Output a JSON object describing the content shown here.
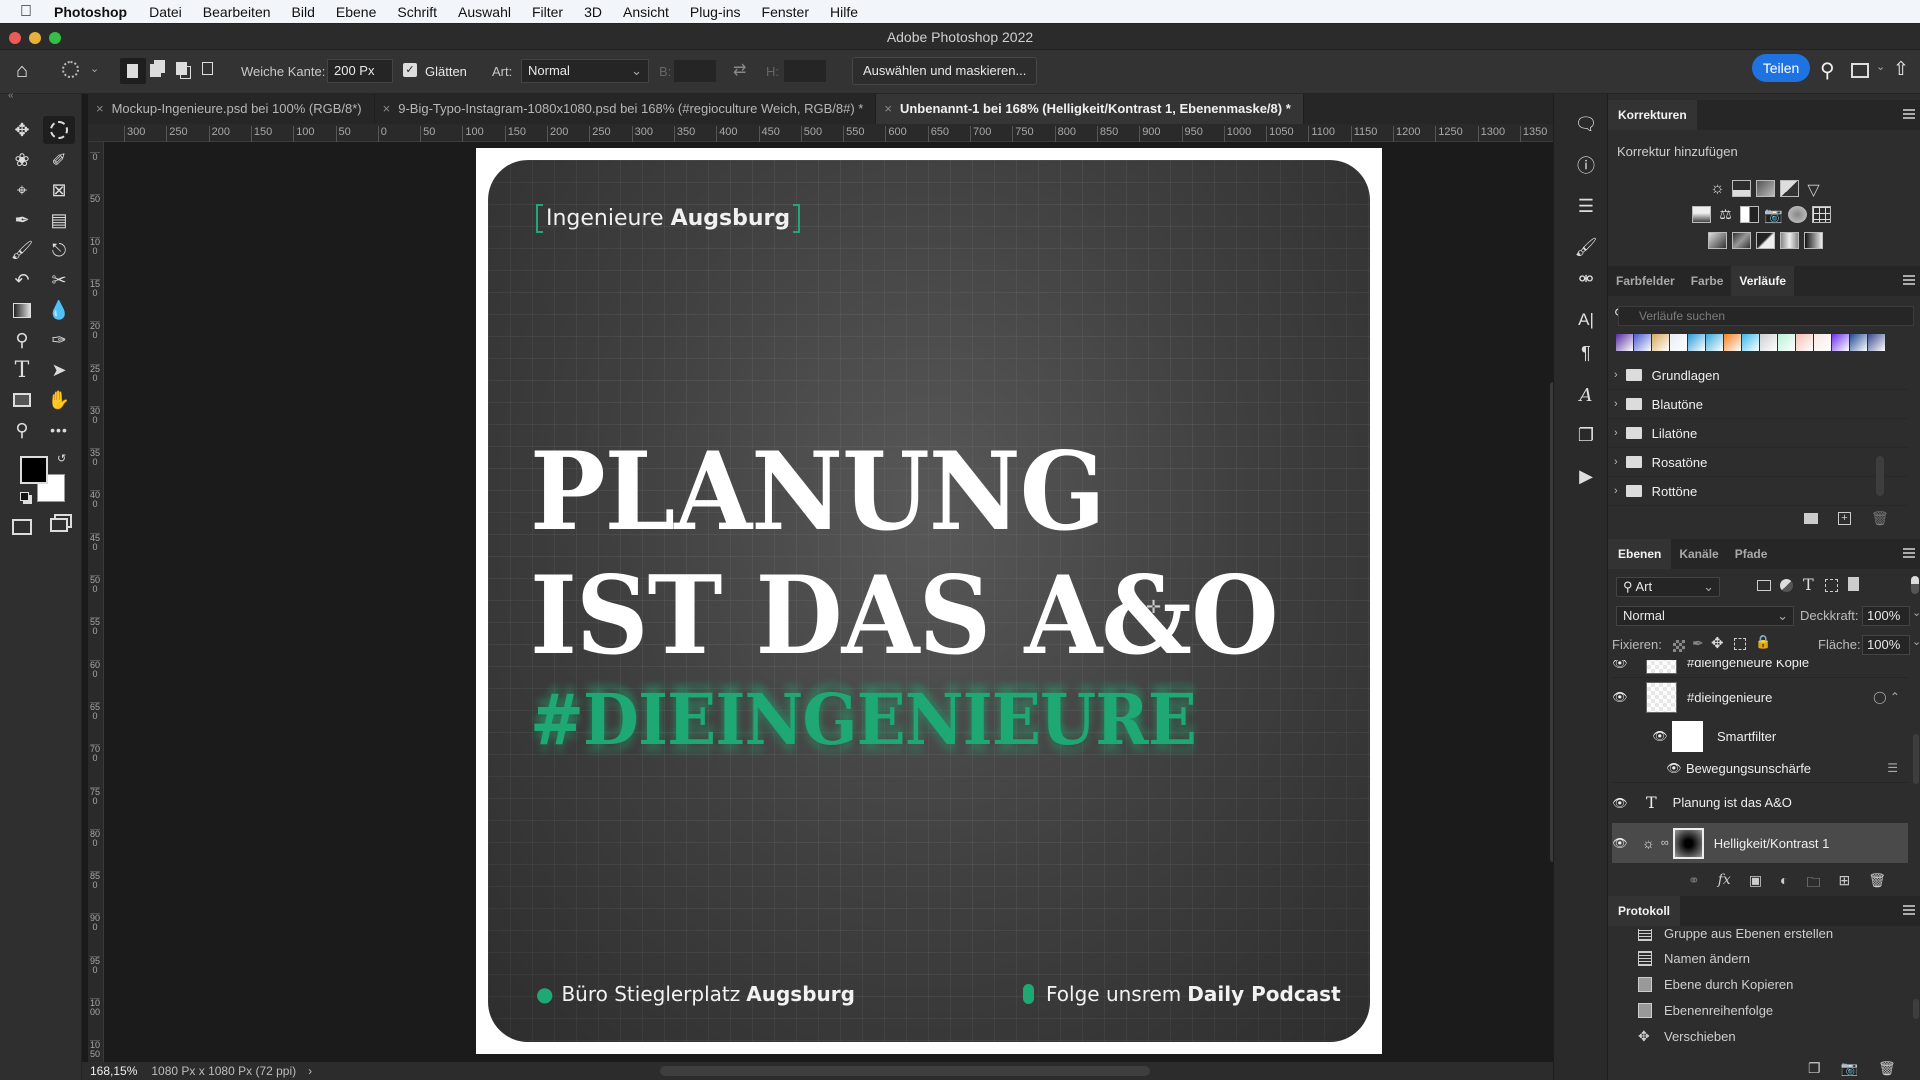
{
  "menubar": {
    "apple_icon": "apple-logo-icon",
    "app": "Photoshop",
    "items": [
      "Datei",
      "Bearbeiten",
      "Bild",
      "Ebene",
      "Schrift",
      "Auswahl",
      "Filter",
      "3D",
      "Ansicht",
      "Plug-ins",
      "Fenster",
      "Hilfe"
    ]
  },
  "window": {
    "title": "Adobe Photoshop 2022"
  },
  "options": {
    "feather_label": "Weiche Kante:",
    "feather_value": "200 Px",
    "antialias_label": "Glätten",
    "antialias_checked": true,
    "style_label": "Art:",
    "style_value": "Normal",
    "width_label": "B:",
    "height_label": "H:",
    "select_mask_button": "Auswählen und maskieren...",
    "share_button": "Teilen"
  },
  "tabs": [
    {
      "label": "Mockup-Ingenieure.psd bei 100% (RGB/8*)",
      "active": false
    },
    {
      "label": "9-Big-Typo-Instagram-1080x1080.psd bei 168% (#regioculture Weich, RGB/8#) *",
      "active": false
    },
    {
      "label": "Unbenannt-1 bei 168% (Helligkeit/Kontrast 1, Ebenenmaske/8) *",
      "active": true
    }
  ],
  "rulers": {
    "horizontal": [
      "300",
      "250",
      "200",
      "150",
      "100",
      "50",
      "0",
      "50",
      "100",
      "150",
      "200",
      "250",
      "300",
      "350",
      "400",
      "450",
      "500",
      "550",
      "600",
      "650",
      "700",
      "750",
      "800",
      "850",
      "900",
      "950",
      "1000",
      "1050",
      "1100",
      "1150",
      "1200",
      "1250",
      "1300",
      "1350"
    ],
    "vertical": [
      "0",
      "50",
      "100",
      "150",
      "200",
      "250",
      "300",
      "350",
      "400",
      "450",
      "500",
      "550",
      "600",
      "650",
      "700",
      "750",
      "800",
      "850",
      "900",
      "950",
      "1000",
      "1050"
    ]
  },
  "artwork": {
    "brand_regular": "Ingenieure",
    "brand_bold": "Augsburg",
    "headline_line1": "PLANUNG",
    "headline_line2": "IST DAS A&O",
    "hashtag": "#DIEINGENIEURE",
    "footer_left_regular": "Büro Stieglerplatz",
    "footer_left_bold": "Augsburg",
    "footer_right_regular": "Folge unsrem",
    "footer_right_bold": "Daily Podcast",
    "accent_color": "#1ea873"
  },
  "status": {
    "zoom": "168,15%",
    "doc_info": "1080 Px x 1080 Px (72 ppi)",
    "arrow": "›"
  },
  "panels": {
    "adjustments": {
      "tab": "Korrekturen",
      "subtitle": "Korrektur hinzufügen"
    },
    "gradients": {
      "tabs": [
        "Farbfelder",
        "Farbe",
        "Verläufe"
      ],
      "active_tab": "Verläufe",
      "search_placeholder": "Verläufe suchen",
      "swatches": [
        "#5a2ca0",
        "#4a5ad0",
        "#d8a85a",
        "#e8ecf6",
        "#2a9ad8",
        "#3aa8d8",
        "#f48020",
        "#38b8e8",
        "#cfcfcf",
        "#b8f0d8",
        "#f4c0b0",
        "#f8e8e4",
        "#6a30e8",
        "#1e4a90",
        "#3a4a8a"
      ],
      "folders": [
        "Grundlagen",
        "Blautöne",
        "Lilatöne",
        "Rosatöne",
        "Rottöne"
      ]
    },
    "layers": {
      "tabs": [
        "Ebenen",
        "Kanäle",
        "Pfade"
      ],
      "active_tab": "Ebenen",
      "filter_value": "Art",
      "blend_mode": "Normal",
      "opacity_label": "Deckkraft:",
      "opacity_value": "100%",
      "lock_label": "Fixieren:",
      "fill_label": "Fläche:",
      "fill_value": "100%",
      "items": [
        {
          "name": "#dieingenieure Kopie",
          "type": "smart"
        },
        {
          "name": "#dieingenieure",
          "type": "smart"
        },
        {
          "name": "Smartfilter",
          "type": "filter-mask"
        },
        {
          "name": "Bewegungsunschärfe",
          "type": "filter"
        },
        {
          "name": "Planung ist das A&O",
          "type": "text"
        },
        {
          "name": "Helligkeit/Kontrast 1",
          "type": "adjustment",
          "selected": true
        }
      ]
    },
    "history": {
      "tab": "Protokoll",
      "items": [
        "Gruppe aus Ebenen erstellen",
        "Namen ändern",
        "Ebene durch Kopieren",
        "Ebenenreihenfolge",
        "Verschieben"
      ]
    }
  }
}
